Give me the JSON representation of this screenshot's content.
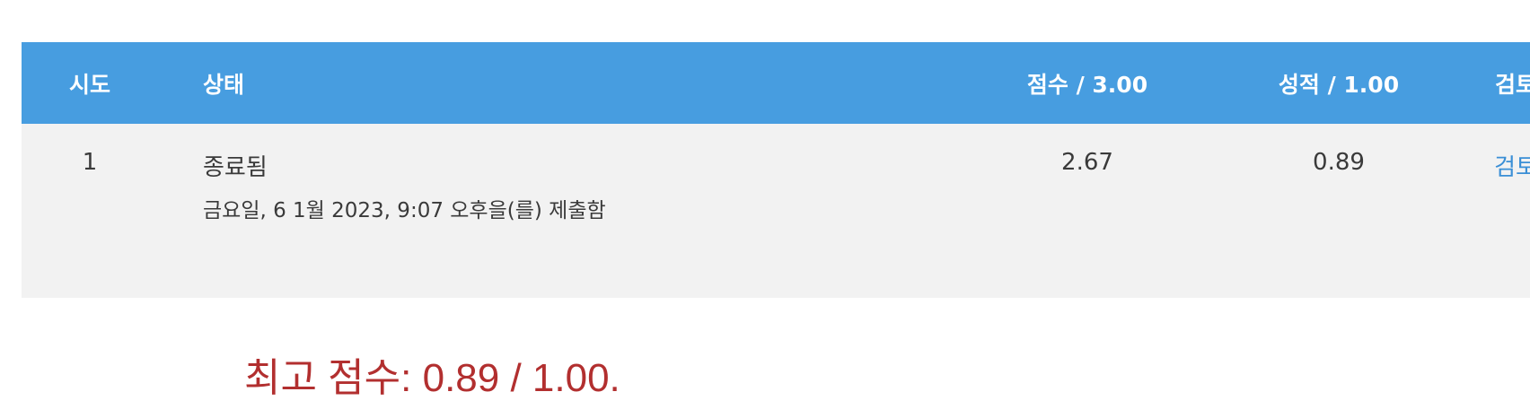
{
  "table": {
    "headers": {
      "attempt": "시도",
      "state": "상태",
      "marks": "점수 / 3.00",
      "grade": "성적 / 1.00",
      "review": "검토"
    },
    "rows": [
      {
        "attempt": "1",
        "state": "종료됨",
        "submitted": "금요일, 6 1월 2023, 9:07 오후을(를) 제출함",
        "marks": "2.67",
        "grade": "0.89",
        "review": "검토"
      }
    ]
  },
  "feedback": {
    "highest_grade": "최고 점수: 0.89 / 1.00."
  },
  "colors": {
    "header_bg": "#479de0",
    "row_bg": "#f2f2f2",
    "link": "#3a8fd6",
    "feedback_text": "#b22f2f"
  }
}
